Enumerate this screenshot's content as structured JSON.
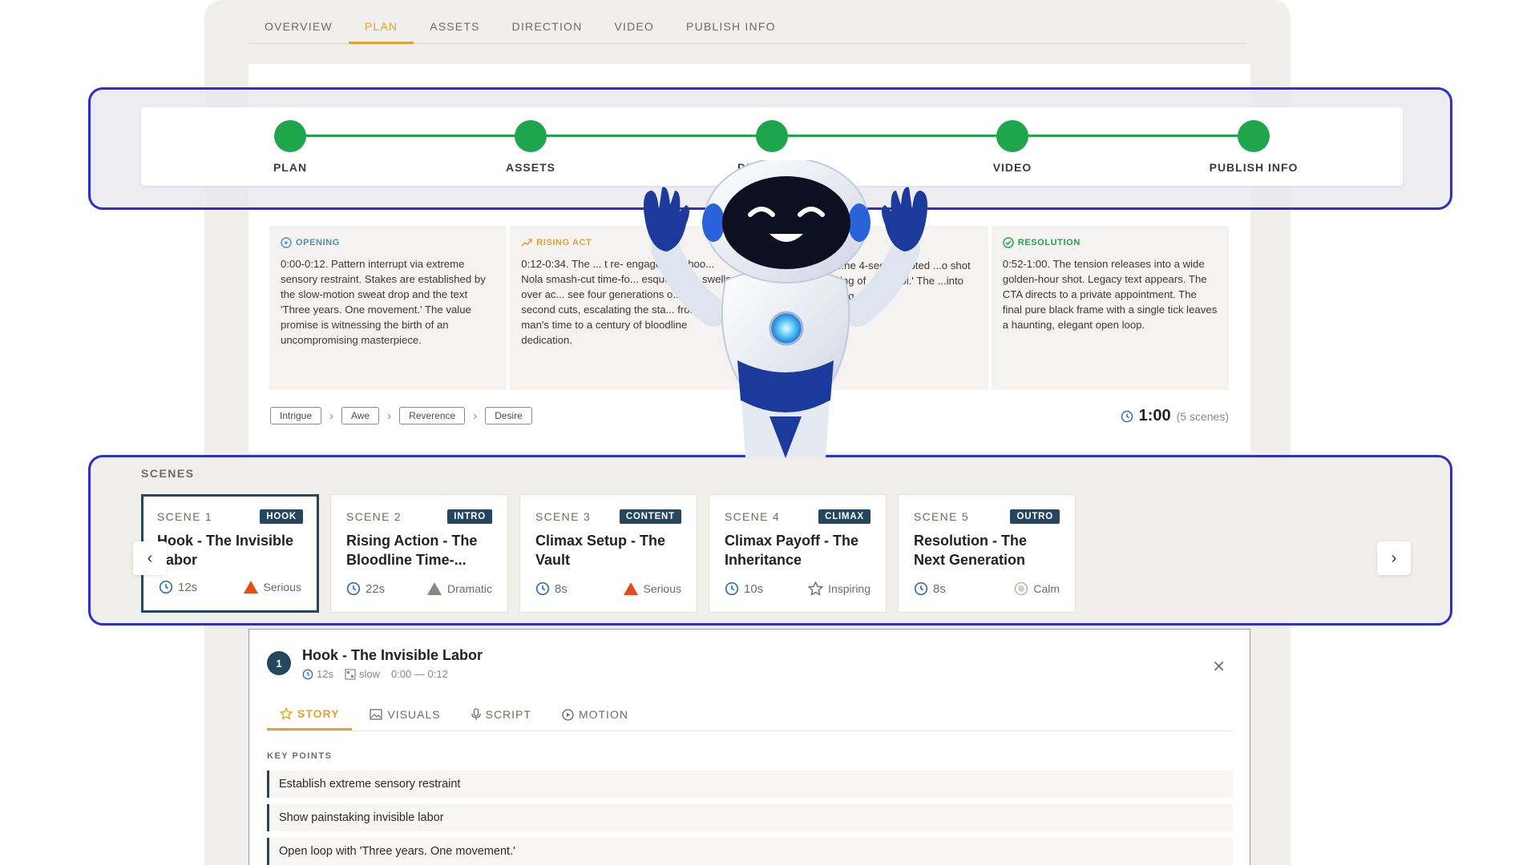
{
  "top_tabs": [
    "OVERVIEW",
    "PLAN",
    "ASSETS",
    "DIRECTION",
    "VIDEO",
    "PUBLISH INFO"
  ],
  "active_top_tab": "PLAN",
  "stepper": {
    "steps": [
      "PLAN",
      "ASSETS",
      "DIRECTION",
      "VIDEO",
      "PUBLISH INFO"
    ],
    "color": "#1fa54b"
  },
  "arc": [
    {
      "label": "OPENING",
      "color": "#4f8fb8",
      "icon": "play-circle-icon",
      "text": "0:00-0:12. Pattern interrupt via extreme sensory restraint. Stakes are established by the slow-motion sweat drop and the text 'Three years. One movement.' The value promise is witnessing the birth of an uncompromising masterpiece."
    },
    {
      "label": "RISING ACT",
      "color": "#e3a12f",
      "icon": "trending-up-icon",
      "text": "0:12-0:34. The ... t re- engagement hoo... Nola smash-cut time-fo... esque brass swells over ac... see four generations o... 1.5-second cuts, escalating the sta... from one man's time to a century of bloodline dedication."
    },
    {
      "label": "",
      "color": "#b04a4a",
      "icon": "",
      "text": "...0 percer... ne ...he 4-sec... rrupted ...o shot of t... 388 ...passing of ...st a toi.' The ...into absolute, deafening ...2."
    },
    {
      "label": "RESOLUTION",
      "color": "#1fa54b",
      "icon": "check-circle-icon",
      "text": "0:52-1:00. The tension releases into a wide golden-hour shot. Legacy text appears. The CTA directs to a private appointment. The final pure black frame with a single tick leaves a haunting, elegant open loop."
    }
  ],
  "emotions": [
    "Intrigue",
    "Awe",
    "Reverence",
    "Desire"
  ],
  "total_duration": "1:00",
  "total_scenes": "(5 scenes)",
  "scenes_title": "SCENES",
  "scenes": [
    {
      "num": "SCENE 1",
      "badge": "HOOK",
      "name": "Hook - The Invisible Labor",
      "dur": "12s",
      "tone": "Serious",
      "tone_icon": "triangle-icon",
      "tone_color": "#e24d1b"
    },
    {
      "num": "SCENE 2",
      "badge": "INTRO",
      "name": "Rising Action - The Bloodline Time-...",
      "dur": "22s",
      "tone": "Dramatic",
      "tone_icon": "triangle-icon",
      "tone_color": "#8a8782"
    },
    {
      "num": "SCENE 3",
      "badge": "CONTENT",
      "name": "Climax Setup - The Vault",
      "dur": "8s",
      "tone": "Serious",
      "tone_icon": "triangle-icon",
      "tone_color": "#e24d1b"
    },
    {
      "num": "SCENE 4",
      "badge": "CLIMAX",
      "name": "Climax Payoff - The Inheritance",
      "dur": "10s",
      "tone": "Inspiring",
      "tone_icon": "star-icon",
      "tone_color": "#8a8782"
    },
    {
      "num": "SCENE 5",
      "badge": "OUTRO",
      "name": "Resolution - The Next Generation",
      "dur": "8s",
      "tone": "Calm",
      "tone_icon": "calm-icon",
      "tone_color": "#b0ada8"
    }
  ],
  "detail": {
    "num": "1",
    "title": "Hook - The Invisible Labor",
    "dur": "12s",
    "pace": "slow",
    "range": "0:00 — 0:12",
    "tabs": [
      "STORY",
      "VISUALS",
      "SCRIPT",
      "MOTION"
    ],
    "key_points_title": "KEY POINTS",
    "key_points": [
      "Establish extreme sensory restraint",
      "Show painstaking invisible labor",
      "Open loop with 'Three years. One movement.'"
    ]
  },
  "accent_color": "#e3a12f",
  "frame_color": "#2c2fd0",
  "navy": "#24465e"
}
